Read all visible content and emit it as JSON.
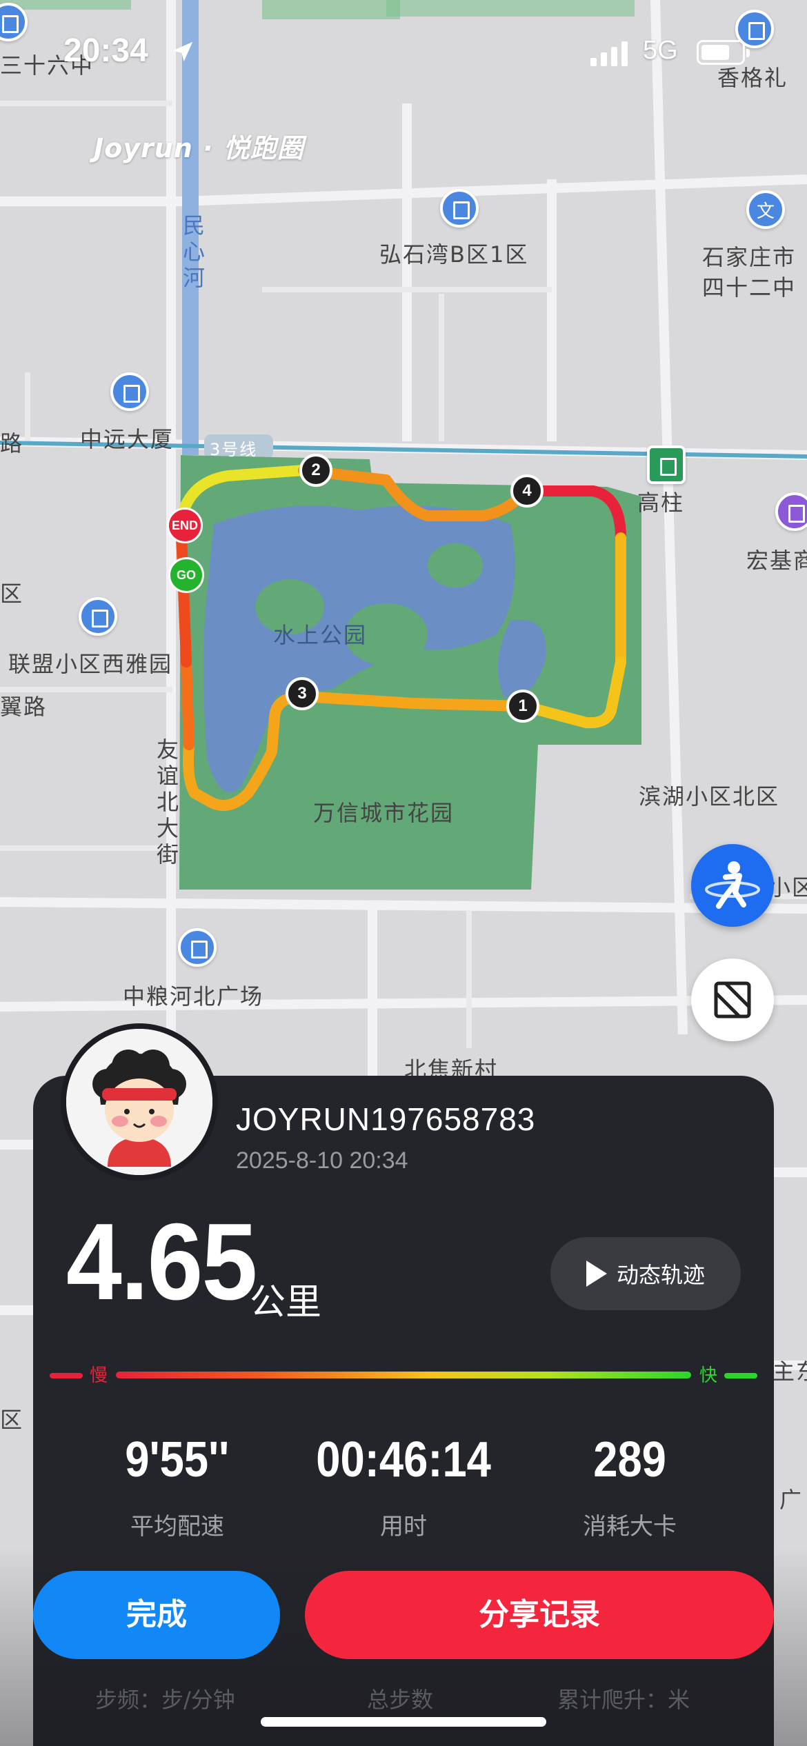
{
  "status_bar": {
    "time": "20:34",
    "network": "5G"
  },
  "watermark": "Joyrun · 悦跑圈",
  "map": {
    "labels": {
      "top_left_partial": "三十六中",
      "top_right": "香格礼",
      "hongshiwan": "弘石湾B区1区",
      "school_right_1": "石家庄市",
      "school_right_2": "四十二中",
      "minxin_river": "民心河",
      "zhongyuan": "中远大厦",
      "metro_line": "3号线",
      "gaozhu": "高柱",
      "hongji": "宏基商",
      "left_road_partial": "路",
      "left_qu_1": "区",
      "lianmeng": "联盟小区西雅园",
      "yi_road": "翼路",
      "park": "水上公园",
      "wanxin": "万信城市花园",
      "binhu": "滨湖小区北区",
      "youyi_street": "友谊北大街",
      "zhongliang": "中粮河北广场",
      "beiji": "北焦新村",
      "right_xiaoqu": "小区",
      "right_zhu": "主东",
      "right_guang": "广",
      "left_qu_2": "区"
    },
    "km_markers": [
      "1",
      "2",
      "3",
      "4"
    ],
    "end_label": "END",
    "go_label": "GO"
  },
  "card": {
    "username": "JOYRUN197658783",
    "datetime": "2025-8-10 20:34",
    "distance": "4.65",
    "distance_unit": "公里",
    "replay_label": "动态轨迹",
    "pace_slow": "慢",
    "pace_fast": "快",
    "stats": [
      {
        "value": "9'55''",
        "label": "平均配速"
      },
      {
        "value": "00:46:14",
        "label": "用时"
      },
      {
        "value": "289",
        "label": "消耗大卡"
      }
    ],
    "done_label": "完成",
    "share_label": "分享记录",
    "sub_stats": [
      "步频：步/分钟",
      "总步数",
      "累计爬升：米"
    ]
  },
  "colors": {
    "pace_slow": "#e8223a",
    "pace_fast": "#2ad62a",
    "done_button": "#1188f5",
    "share_button": "#f4263e",
    "card_bg": "#24252b",
    "park_green": "#63a977",
    "water_blue": "#6b8fc4"
  },
  "icons": [
    "location-arrow-icon",
    "signal-icon",
    "battery-icon",
    "building-icon",
    "school-icon",
    "shop-icon",
    "metro-icon",
    "runner-icon",
    "layer-icon",
    "play-icon"
  ]
}
